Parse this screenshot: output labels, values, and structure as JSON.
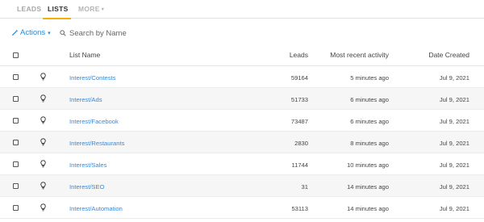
{
  "tabs": [
    {
      "label": "LEADS"
    },
    {
      "label": "LISTS"
    },
    {
      "label": "MORE",
      "caret": "▾"
    }
  ],
  "toolbar": {
    "actions_label": "Actions",
    "actions_caret": "▾",
    "search_placeholder": "Search by Name"
  },
  "table": {
    "columns": {
      "name": "List Name",
      "leads": "Leads",
      "activity": "Most recent activity",
      "date": "Date Created"
    },
    "rows": [
      {
        "name": "Interest/Contests",
        "leads": "59164",
        "activity": "5 minutes ago",
        "date": "Jul 9, 2021"
      },
      {
        "name": "Interest/Ads",
        "leads": "51733",
        "activity": "6 minutes ago",
        "date": "Jul 9, 2021"
      },
      {
        "name": "Interest/Facebook",
        "leads": "73487",
        "activity": "6 minutes ago",
        "date": "Jul 9, 2021"
      },
      {
        "name": "Interest/Restaurants",
        "leads": "2830",
        "activity": "8 minutes ago",
        "date": "Jul 9, 2021"
      },
      {
        "name": "Interest/Sales",
        "leads": "11744",
        "activity": "10 minutes ago",
        "date": "Jul 9, 2021"
      },
      {
        "name": "Interest/SEO",
        "leads": "31",
        "activity": "14 minutes ago",
        "date": "Jul 9, 2021"
      },
      {
        "name": "Interest/Automation",
        "leads": "53113",
        "activity": "14 minutes ago",
        "date": "Jul 9, 2021"
      }
    ]
  },
  "colors": {
    "accent": "#2a8ad6",
    "link": "#3b88d4",
    "tab_underline": "#f0b400",
    "row_alt": "#f6f6f6"
  },
  "icons": {
    "actions": "magic-wand-icon",
    "search": "search-icon",
    "row": "lightbulb-icon"
  }
}
